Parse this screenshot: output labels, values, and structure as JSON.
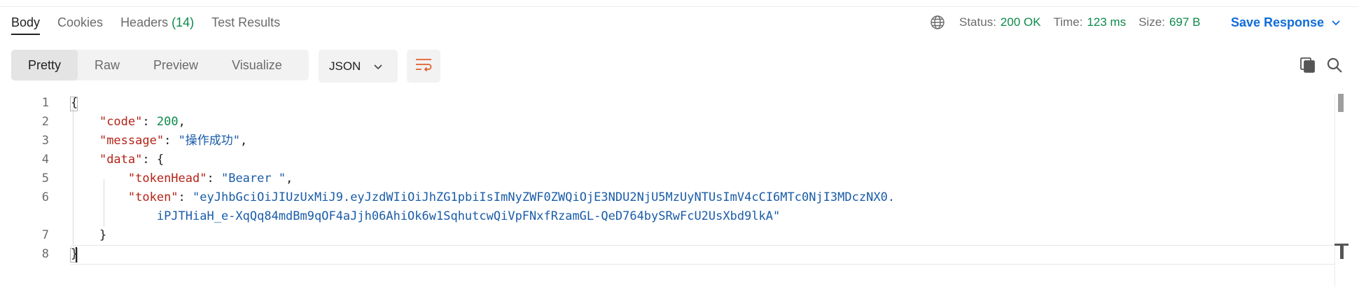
{
  "tabs": {
    "body": "Body",
    "cookies": "Cookies",
    "headers": "Headers",
    "headers_count": "(14)",
    "test_results": "Test Results"
  },
  "status": {
    "globe_icon": "globe-icon",
    "status_label": "Status:",
    "status_value": "200 OK",
    "time_label": "Time:",
    "time_value": "123 ms",
    "size_label": "Size:",
    "size_value": "697 B",
    "save_response": "Save Response"
  },
  "toolbar": {
    "views": [
      "Pretty",
      "Raw",
      "Preview",
      "Visualize"
    ],
    "format": "JSON",
    "wrap_icon": "wrap-lines-icon",
    "copy_icon": "copy-icon",
    "search_icon": "search-icon"
  },
  "editor": {
    "line_numbers": [
      "1",
      "2",
      "3",
      "4",
      "5",
      "6",
      "7",
      "8"
    ],
    "json": {
      "open_brace": "{",
      "code_key": "\"code\"",
      "code_value": "200",
      "message_key": "\"message\"",
      "message_value": "\"操作成功\"",
      "data_key": "\"data\"",
      "data_open": "{",
      "tokenHead_key": "\"tokenHead\"",
      "tokenHead_value": "\"Bearer \"",
      "token_key": "\"token\"",
      "token_value_part1": "\"eyJhbGciOiJIUzUxMiJ9.eyJzdWIiOiJhZG1pbiIsImNyZWF0ZWQiOjE3NDU2NjU5MzUyNTUsImV4cCI6MTc0NjI3MDczNX0.",
      "token_value_part2": "iPJTHiaH_e-XqQq84mdBm9qOF4aJjh06AhiOk6w1SqhutcwQiVpFNxfRzamGL-QeD764bySRwFcU2UsXbd9lkA\"",
      "data_close": "}",
      "close_brace": "}"
    }
  },
  "colors": {
    "status_green": "#0d8a4a",
    "link_blue": "#0f6cd9",
    "json_key": "#b42318",
    "json_string": "#1a5ca8",
    "wrap_orange": "#e35d2a"
  }
}
